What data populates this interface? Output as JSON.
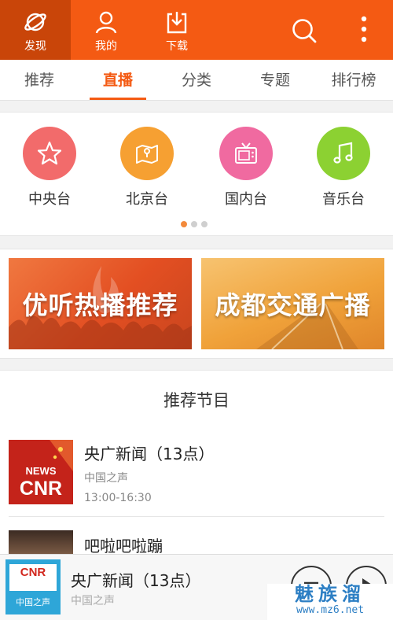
{
  "topbar": {
    "nav": [
      {
        "label": "发现",
        "icon": "planet-icon"
      },
      {
        "label": "我的",
        "icon": "user-icon"
      },
      {
        "label": "下载",
        "icon": "download-icon"
      }
    ],
    "accent": "#f45a13"
  },
  "tabs": [
    "推荐",
    "直播",
    "分类",
    "专题",
    "排行榜"
  ],
  "active_tab": "直播",
  "channels": [
    {
      "name": "中央台",
      "icon": "star-icon",
      "color": "#f26b6b"
    },
    {
      "name": "北京台",
      "icon": "map-icon",
      "color": "#f6a032"
    },
    {
      "name": "国内台",
      "icon": "tv-icon",
      "color": "#f06aa0"
    },
    {
      "name": "音乐台",
      "icon": "music-note-icon",
      "color": "#8cd132"
    }
  ],
  "banners": [
    "优听热播推荐",
    "成都交通广播"
  ],
  "recommend": {
    "title": "推荐节目",
    "items": [
      {
        "title": "央广新闻（13点）",
        "subtitle": "中国之声",
        "time": "13:00-16:30",
        "thumb_lines": [
          "NEWS",
          "CNR"
        ]
      },
      {
        "title": "吧啦吧啦蹦"
      }
    ]
  },
  "player": {
    "title": "央广新闻（13点）",
    "subtitle": "中国之声",
    "thumb_logo": "CNR",
    "thumb_caption": "中国之声"
  },
  "watermark": {
    "line1": "魅族溜",
    "line2": "www.mz6.net"
  }
}
